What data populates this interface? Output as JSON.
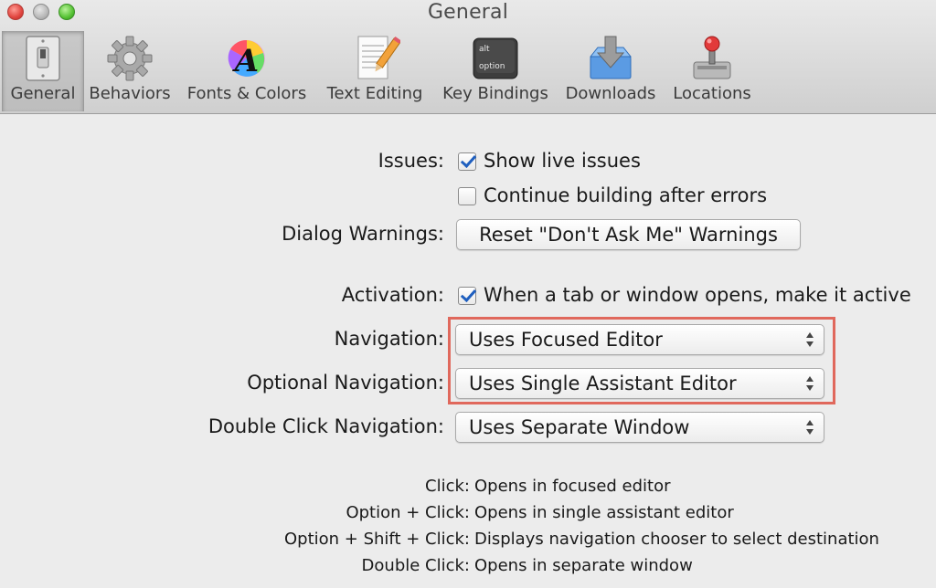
{
  "window": {
    "title": "General"
  },
  "toolbar": {
    "items": [
      {
        "label": "General",
        "icon": "light-switch-icon",
        "selected": true
      },
      {
        "label": "Behaviors",
        "icon": "gear-icon"
      },
      {
        "label": "Fonts & Colors",
        "icon": "font-color-wheel-icon"
      },
      {
        "label": "Text Editing",
        "icon": "paper-pencil-icon"
      },
      {
        "label": "Key Bindings",
        "icon": "keyboard-key-icon",
        "key_top": "alt",
        "key_bottom": "option"
      },
      {
        "label": "Downloads",
        "icon": "download-arrow-icon"
      },
      {
        "label": "Locations",
        "icon": "joystick-drive-icon"
      }
    ]
  },
  "issues": {
    "label": "Issues:",
    "show_live_issues": {
      "label": "Show live issues",
      "checked": true
    },
    "continue_building": {
      "label": "Continue building after errors",
      "checked": false
    }
  },
  "dialog_warnings": {
    "label": "Dialog Warnings:",
    "button": "Reset \"Don't Ask Me\" Warnings"
  },
  "activation": {
    "label": "Activation:",
    "checkbox": {
      "label": "When a tab or window opens, make it active",
      "checked": true
    }
  },
  "navigation": {
    "label": "Navigation:",
    "value": "Uses Focused Editor"
  },
  "optional_navigation": {
    "label": "Optional Navigation:",
    "value": "Uses Single Assistant Editor"
  },
  "double_click_navigation": {
    "label": "Double Click Navigation:",
    "value": "Uses Separate Window"
  },
  "help": [
    {
      "gesture": "Click:",
      "action": "Opens in focused editor"
    },
    {
      "gesture": "Option + Click:",
      "action": "Opens in single assistant editor"
    },
    {
      "gesture": "Option + Shift + Click:",
      "action": "Displays navigation chooser to select destination"
    },
    {
      "gesture": "Double Click:",
      "action": "Opens in separate window"
    }
  ],
  "colors": {
    "highlight": "#e0685c",
    "checkmark": "#1f5fbf"
  }
}
